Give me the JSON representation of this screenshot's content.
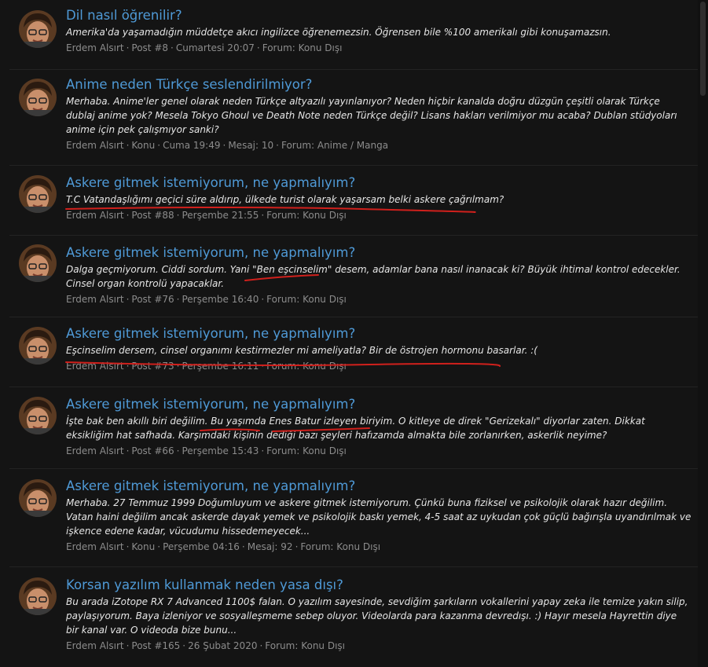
{
  "results": [
    {
      "title": "Dil nasıl öğrenilir?",
      "snippet": "Amerika'da yaşamadığın müddetçe akıcı ingilizce öğrenemezsin. Öğrensen bile %100 amerikalı gibi konuşamazsın.",
      "author": "Erdem Alsırt",
      "kind": "Post #8",
      "date": "Cumartesi 20:07",
      "forum": "Forum: Konu Dışı"
    },
    {
      "title": "Anime neden Türkçe seslendirilmiyor?",
      "snippet": "Merhaba. Anime'ler genel olarak neden Türkçe altyazılı yayınlanıyor? Neden hiçbir kanalda doğru düzgün çeşitli olarak Türkçe dublaj anime yok? Mesela Tokyo Ghoul ve Death Note neden Türkçe değil? Lisans hakları verilmiyor mu acaba? Dublan stüdyoları anime için pek çalışmıyor sanki?",
      "author": "Erdem Alsırt",
      "kind": "Konu",
      "date": "Cuma 19:49",
      "replies": "Mesaj: 10",
      "forum": "Forum: Anime / Manga"
    },
    {
      "title": "Askere gitmek istemiyorum, ne yapmalıyım?",
      "snippet": "T.C Vatandaşlığımı geçici süre aldırıp, ülkede turist olarak yaşarsam belki askere çağrılmam?",
      "author": "Erdem Alsırt",
      "kind": "Post #88",
      "date": "Perşembe 21:55",
      "forum": "Forum: Konu Dışı"
    },
    {
      "title": "Askere gitmek istemiyorum, ne yapmalıyım?",
      "snippet": "Dalga geçmiyorum. Ciddi sordum. Yani \"Ben eşcinselim\" desem, adamlar bana nasıl inanacak ki? Büyük ihtimal kontrol edecekler. Cinsel organ kontrolü yapacaklar.",
      "author": "Erdem Alsırt",
      "kind": "Post #76",
      "date": "Perşembe 16:40",
      "forum": "Forum: Konu Dışı"
    },
    {
      "title": "Askere gitmek istemiyorum, ne yapmalıyım?",
      "snippet": "Eşcinselim dersem, cinsel organımı kestirmezler mi ameliyatla? Bir de östrojen hormonu basarlar. :(",
      "author": "Erdem Alsırt",
      "kind": "Post #73",
      "date": "Perşembe 16:11",
      "forum": "Forum: Konu Dışı"
    },
    {
      "title": "Askere gitmek istemiyorum, ne yapmalıyım?",
      "snippet": "İşte bak ben akıllı biri değilim. Bu yaşımda Enes Batur izleyen biriyim. O kitleye de direk \"Gerizekalı\" diyorlar zaten. Dikkat eksikliğim hat safhada. Karşımdaki kişinin dediği bazı şeyleri hafızamda almakta bile zorlanırken, askerlik neyime?",
      "author": "Erdem Alsırt",
      "kind": "Post #66",
      "date": "Perşembe 15:43",
      "forum": "Forum: Konu Dışı"
    },
    {
      "title": "Askere gitmek istemiyorum, ne yapmalıyım?",
      "snippet": "Merhaba. 27 Temmuz 1999 Doğumluyum ve askere gitmek istemiyorum. Çünkü buna fiziksel ve psikolojik olarak hazır değilim. Vatan haini değilim ancak askerde dayak yemek ve psikolojik baskı yemek, 4-5 saat az uykudan çok güçlü bağırışla uyandırılmak ve işkence edene kadar, vücudumu hissedemeyecek...",
      "author": "Erdem Alsırt",
      "kind": "Konu",
      "date": "Perşembe 04:16",
      "replies": "Mesaj: 92",
      "forum": "Forum: Konu Dışı"
    },
    {
      "title": "Korsan yazılım kullanmak neden yasa dışı?",
      "snippet": "Bu arada iZotope RX 7 Advanced 1100$ falan. O yazılım sayesinde, sevdiğim şarkıların vokallerini yapay zeka ile temize yakın silip, paylaşıyorum. Baya izleniyor ve sosyalleşmeme sebep oluyor. Videolarda para kazanma devredışı. :) Hayır mesela Hayrettin diye bir kanal var. O videoda bize bunu...",
      "author": "Erdem Alsırt",
      "kind": "Post #165",
      "date": "26 Şubat 2020",
      "forum": "Forum: Konu Dışı"
    }
  ],
  "meta_separator": "·",
  "colors": {
    "background": "#141414",
    "title_link": "#4f9ad7",
    "snippet_text": "#e6e6e6",
    "meta_text": "#8c8c8c",
    "annotation": "#d0201c"
  }
}
